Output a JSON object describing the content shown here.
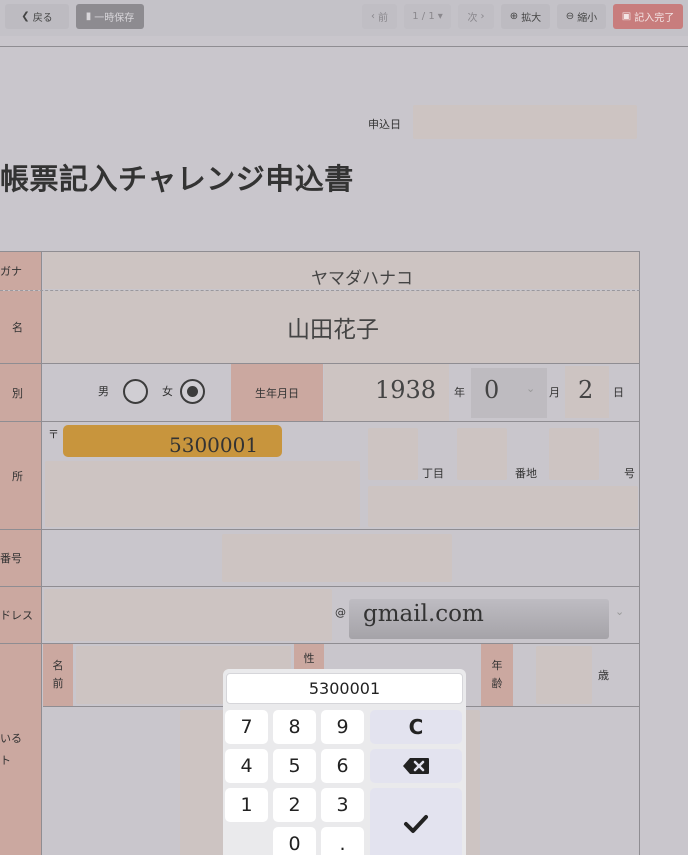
{
  "toolbar": {
    "back": "戻る",
    "save_draft": "一時保存",
    "prev": "前",
    "page": "1 / 1",
    "next": "次",
    "zoom_in": "拡大",
    "zoom_out": "縮小",
    "finish": "記入完了"
  },
  "header": {
    "apply_date_label": "申込日",
    "title": "帳票記入チャレンジ申込書"
  },
  "form": {
    "furigana_label": "ガナ",
    "furigana_value": "ヤマダハナコ",
    "name_label": "名",
    "name_value": "山田花子",
    "gender_label": "別",
    "gender_male": "男",
    "gender_female": "女",
    "gender_selected": "女",
    "dob_label": "生年月日",
    "dob_year": "1938",
    "dob_year_unit": "年",
    "dob_month": "0",
    "dob_month_unit": "月",
    "dob_day": "2",
    "dob_day_unit": "日",
    "address_label": "所",
    "postal_mark": "〒",
    "postal_value": "5300001",
    "chome_label": "丁目",
    "banchi_label": "番地",
    "go_label": "号",
    "phone_label": "番号",
    "email_label": "ドレス",
    "email_at": "@",
    "email_domain": "gmail.com",
    "family_name_label": "名\n前",
    "family_gender_label": "性",
    "family_age_label": "年\n齢",
    "family_age_unit": "歳",
    "family_section_label": "いる\nト"
  },
  "keypad": {
    "display": "5300001",
    "keys": [
      "7",
      "8",
      "9",
      "4",
      "5",
      "6",
      "1",
      "2",
      "3",
      "0",
      "."
    ],
    "clear": "C"
  },
  "colors": {
    "overlay_bg": "#c9c6cc",
    "field_bg": "#cdc4c2",
    "label_bg": "#cba8a0",
    "postal_highlight": "#c8953d",
    "finish_button": "#c87d7d"
  }
}
